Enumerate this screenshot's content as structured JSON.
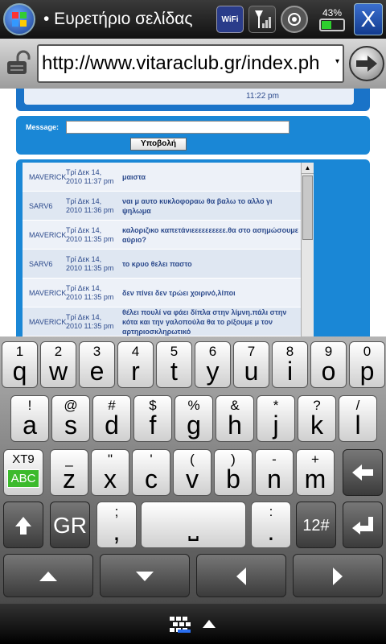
{
  "status": {
    "title": "• Ευρετήριο σελίδας",
    "battery": "43%",
    "battery_level": 0.43
  },
  "address": {
    "url": "http://www.vitaraclub.gr/index.ph"
  },
  "page": {
    "top_time": "11:22 pm",
    "message_label": "Message:",
    "submit_label": "Υποβολή",
    "chat": [
      {
        "name": "MAVERICK",
        "time": "Τρί Δεκ 14, 2010 11:37 pm",
        "msg": "μαιστα"
      },
      {
        "name": "SARV6",
        "time": "Τρί Δεκ 14, 2010 11:36 pm",
        "msg": "ναι μ αυτο κυκλοφοραω θα βαλω το αλλο γι ψηλωμα"
      },
      {
        "name": "MAVERICK",
        "time": "Τρί Δεκ 14, 2010 11:35 pm",
        "msg": "καλοριζικο καπετάνιεεεεεεεεεε.θα στο ασημώσουμε αύριο?"
      },
      {
        "name": "SARV6",
        "time": "Τρί Δεκ 14, 2010 11:35 pm",
        "msg": "το κρυο θελει παστο"
      },
      {
        "name": "MAVERICK",
        "time": "Τρί Δεκ 14, 2010 11:35 pm",
        "msg": "δεν πίνει δεν τρώει χοιρινό,λίποι"
      },
      {
        "name": "MAVERICK",
        "time": "Τρί Δεκ 14, 2010 11:35 pm",
        "msg": "θέλει πουλί να φάει δίπλα στην λίμνη.πάλι στην κότα και την γαλοπούλα θα το ρίξουμε μ τον αρτηριοσκληρωτικό"
      }
    ]
  },
  "keyboard": {
    "row1": [
      {
        "t": "1",
        "m": "q"
      },
      {
        "t": "2",
        "m": "w"
      },
      {
        "t": "3",
        "m": "e"
      },
      {
        "t": "4",
        "m": "r"
      },
      {
        "t": "5",
        "m": "t"
      },
      {
        "t": "6",
        "m": "y"
      },
      {
        "t": "7",
        "m": "u"
      },
      {
        "t": "8",
        "m": "i"
      },
      {
        "t": "9",
        "m": "o"
      },
      {
        "t": "0",
        "m": "p"
      }
    ],
    "row2": [
      {
        "t": "!",
        "m": "a"
      },
      {
        "t": "@",
        "m": "s"
      },
      {
        "t": "#",
        "m": "d"
      },
      {
        "t": "$",
        "m": "f"
      },
      {
        "t": "%",
        "m": "g"
      },
      {
        "t": "&",
        "m": "h"
      },
      {
        "t": "*",
        "m": "j"
      },
      {
        "t": "?",
        "m": "k"
      },
      {
        "t": "/",
        "m": "l"
      }
    ],
    "row3": [
      {
        "t": "_",
        "m": "z"
      },
      {
        "t": "\"",
        "m": "x"
      },
      {
        "t": "'",
        "m": "c"
      },
      {
        "t": "(",
        "m": "v"
      },
      {
        "t": ")",
        "m": "b"
      },
      {
        "t": "-",
        "m": "n"
      },
      {
        "t": "+",
        "m": "m"
      }
    ],
    "xt9": "XT9",
    "abc": "ABC",
    "gr": "GR",
    "semi": ";",
    "comma": ",",
    "colon": ":",
    "dot": ".",
    "num": "12#",
    "space": "⎵"
  }
}
